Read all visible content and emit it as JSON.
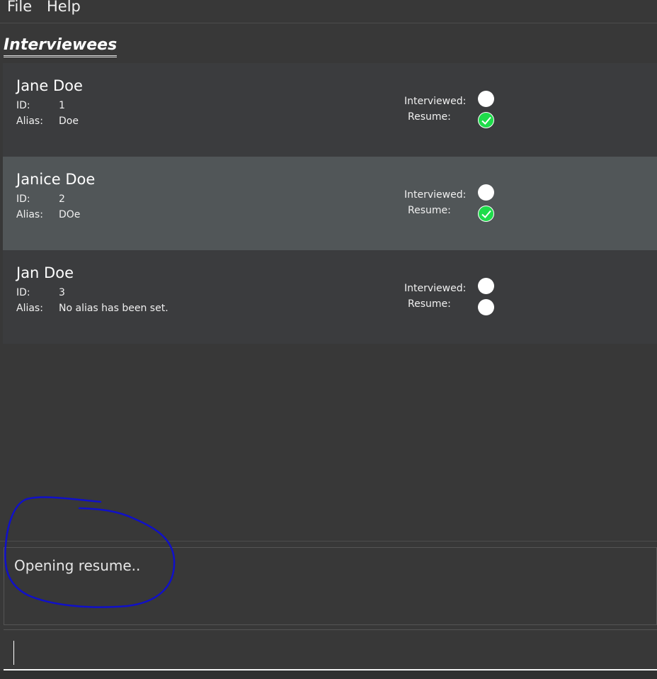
{
  "menu": {
    "file": "File",
    "help": "Help"
  },
  "list": {
    "title": "Interviewees",
    "items": [
      {
        "name": "Jane Doe",
        "id_label": "ID:",
        "id": "1",
        "alias_label": "Alias:",
        "alias": "Doe",
        "interviewed_label": "Interviewed:",
        "interviewed": false,
        "resume_label": "Resume:",
        "resume": true,
        "selected": false
      },
      {
        "name": "Janice Doe",
        "id_label": "ID:",
        "id": "2",
        "alias_label": "Alias:",
        "alias": "DOe",
        "interviewed_label": "Interviewed:",
        "interviewed": false,
        "resume_label": "Resume:",
        "resume": true,
        "selected": true
      },
      {
        "name": "Jan Doe",
        "id_label": "ID:",
        "id": "3",
        "alias_label": "Alias:",
        "alias": "No alias has been set.",
        "interviewed_label": "Interviewed:",
        "interviewed": false,
        "resume_label": "Resume:",
        "resume": false,
        "selected": false
      }
    ]
  },
  "result": {
    "text": "Opening resume.."
  },
  "command": {
    "value": ""
  },
  "colors": {
    "check_green": "#1edc4a",
    "annotation_blue": "#1010c8",
    "selected_card": "#515658"
  }
}
